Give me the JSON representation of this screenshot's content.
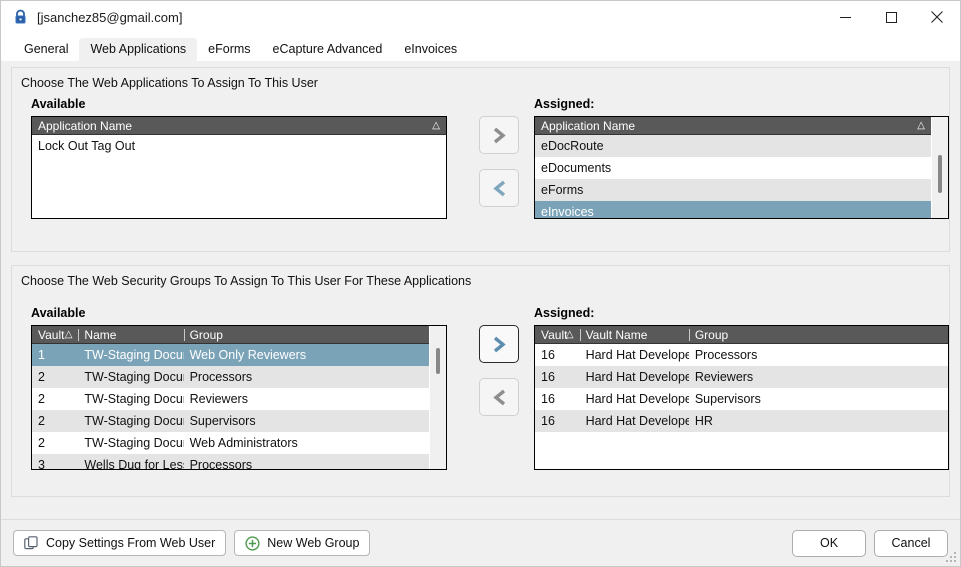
{
  "window": {
    "title": "[jsanchez85@gmail.com]",
    "lock_icon": "lock-icon",
    "minimize_glyph": "—",
    "maximize_glyph": "□",
    "close_glyph": "✕"
  },
  "tabs": [
    {
      "label": "General",
      "active": false
    },
    {
      "label": "Web Applications",
      "active": true
    },
    {
      "label": "eForms",
      "active": false
    },
    {
      "label": "eCapture Advanced",
      "active": false
    },
    {
      "label": "eInvoices",
      "active": false
    }
  ],
  "apps_section": {
    "caption": "Choose The Web Applications To Assign To This User",
    "available_label": "Available",
    "assigned_label": "Assigned:",
    "columns": {
      "application_name": "Application Name",
      "sort_mark": "△"
    },
    "available_rows": [
      {
        "name": "Lock Out Tag Out",
        "selected": false
      }
    ],
    "assigned_rows": [
      {
        "name": "eDocRoute",
        "selected": false
      },
      {
        "name": "eDocuments",
        "selected": false
      },
      {
        "name": "eForms",
        "selected": false
      },
      {
        "name": "eInvoices",
        "selected": true
      }
    ],
    "move_right_label": "❯",
    "move_left_label": "❮"
  },
  "groups_section": {
    "caption": "Choose The Web Security Groups To Assign To This User For These Applications",
    "available_label": "Available",
    "assigned_label": "Assigned:",
    "available_columns": {
      "vault": "Vault",
      "name": "Name",
      "group": "Group",
      "sort_mark": "△"
    },
    "assigned_columns": {
      "vault": "Vault",
      "vault_name": "Vault Name",
      "group": "Group",
      "sort_mark": "△"
    },
    "available_rows": [
      {
        "vault": "1",
        "name": "TW-Staging Documents",
        "group": "Web Only Reviewers",
        "selected": true
      },
      {
        "vault": "2",
        "name": "TW-Staging Documents Test",
        "group": "Processors",
        "selected": false
      },
      {
        "vault": "2",
        "name": "TW-Staging Documents Test",
        "group": "Reviewers",
        "selected": false
      },
      {
        "vault": "2",
        "name": "TW-Staging Documents Test",
        "group": "Supervisors",
        "selected": false
      },
      {
        "vault": "2",
        "name": "TW-Staging Documents Test",
        "group": "Web Administrators",
        "selected": false
      },
      {
        "vault": "3",
        "name": "Wells Dug for Less",
        "group": "Processors",
        "selected": false
      }
    ],
    "assigned_rows": [
      {
        "vault": "16",
        "vault_name": "Hard Hat Developers",
        "group": "Processors",
        "selected": false
      },
      {
        "vault": "16",
        "vault_name": "Hard Hat Developers",
        "group": "Reviewers",
        "selected": false
      },
      {
        "vault": "16",
        "vault_name": "Hard Hat Developers",
        "group": "Supervisors",
        "selected": false
      },
      {
        "vault": "16",
        "vault_name": "Hard Hat Developers",
        "group": "HR",
        "selected": false
      }
    ],
    "move_right_label": "❯",
    "move_left_label": "❮"
  },
  "footer": {
    "copy_settings_label": "Copy Settings From Web User",
    "new_web_group_label": "New Web Group",
    "ok_label": "OK",
    "cancel_label": "Cancel"
  },
  "colors": {
    "selection": "#7ba3b8",
    "header": "#595959",
    "alt_row": "#e4e4e4",
    "accent_blue": "#4e7f9c",
    "disabled_gray": "#8d8d8d",
    "green": "#4e9a4e"
  }
}
